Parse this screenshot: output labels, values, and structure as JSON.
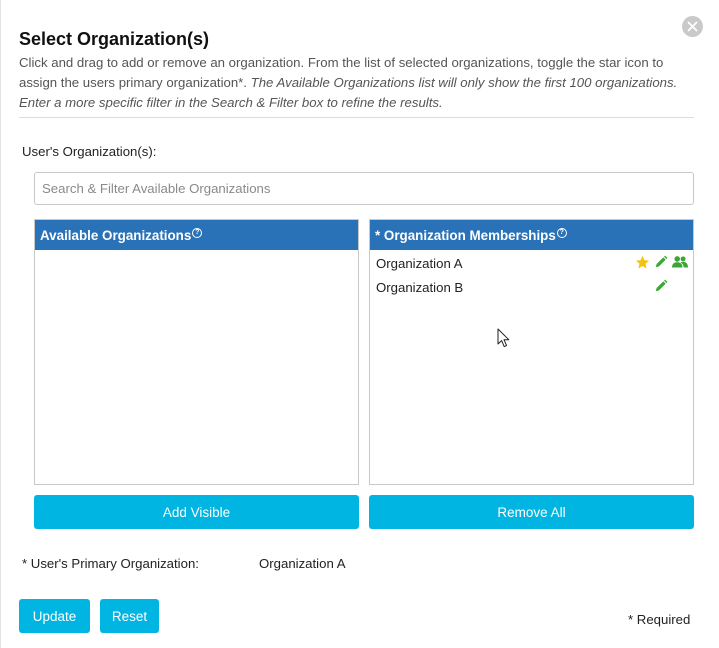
{
  "dialog": {
    "title": "Select Organization(s)",
    "description_normal": "Click and drag to add or remove an organization. From the list of selected organizations, toggle the star icon to assign the users primary organization*.",
    "description_italic": "The Available Organizations list will only show the first 100 organizations. Enter a more specific filter in the Search & Filter box to refine the results.",
    "close_icon": "close-icon"
  },
  "form": {
    "user_orgs_label": "User's Organization(s):",
    "search_placeholder": "Search & Filter Available Organizations",
    "search_value": ""
  },
  "available": {
    "title": "Available Organizations",
    "help_glyph": "?",
    "items": []
  },
  "memberships": {
    "title": "* Organization Memberships",
    "help_glyph": "?",
    "items": [
      {
        "name": "Organization A",
        "primary": true,
        "icons": [
          "star-icon",
          "pencil-icon",
          "users-icon"
        ]
      },
      {
        "name": "Organization B",
        "primary": false,
        "icons": [
          "pencil-icon"
        ]
      }
    ]
  },
  "buttons": {
    "add_visible": "Add Visible",
    "remove_all": "Remove All",
    "update": "Update",
    "reset": "Reset"
  },
  "primary": {
    "label": "* User's Primary Organization:",
    "value": "Organization A"
  },
  "footer": {
    "required_note": "* Required"
  },
  "colors": {
    "header_blue": "#2a72b7",
    "button_cyan": "#00b5e2",
    "star_yellow": "#f2c20f",
    "icon_green": "#3aa635"
  }
}
